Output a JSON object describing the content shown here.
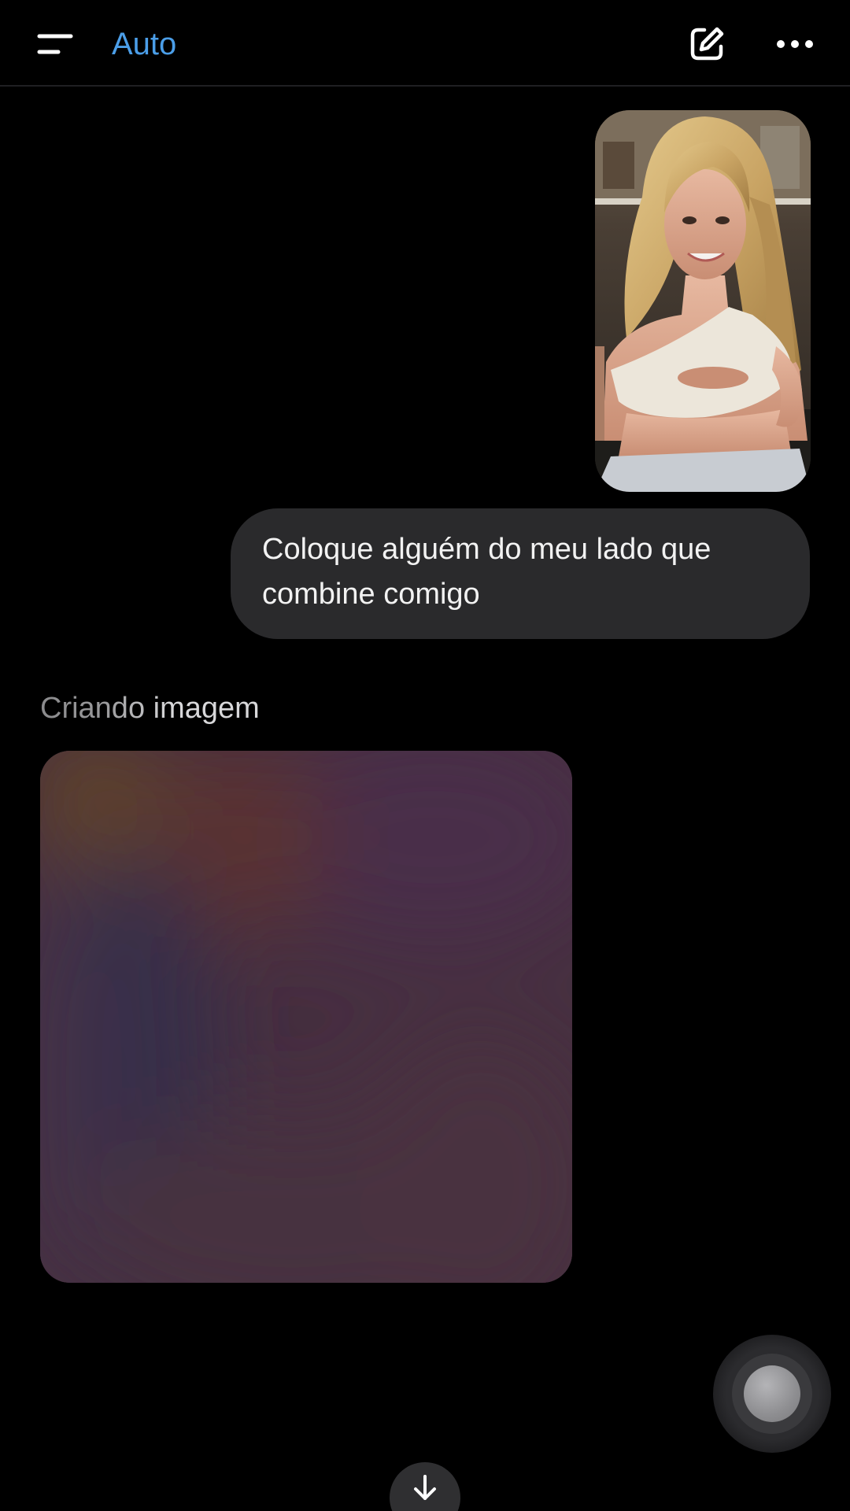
{
  "header": {
    "model_label": "Auto",
    "menu_icon": "menu-lines-icon",
    "compose_icon": "compose-icon",
    "more_icon": "more-dots-icon",
    "accent_color": "#4b9ee8"
  },
  "conversation": {
    "user_message": {
      "attachment": "user-photo",
      "text": "Coloque alguém do meu lado que combine comigo"
    },
    "assistant": {
      "status_text": "Criando imagem"
    }
  },
  "controls": {
    "voice_icon": "voice-orb-icon",
    "scroll_icon": "arrow-down-icon"
  }
}
